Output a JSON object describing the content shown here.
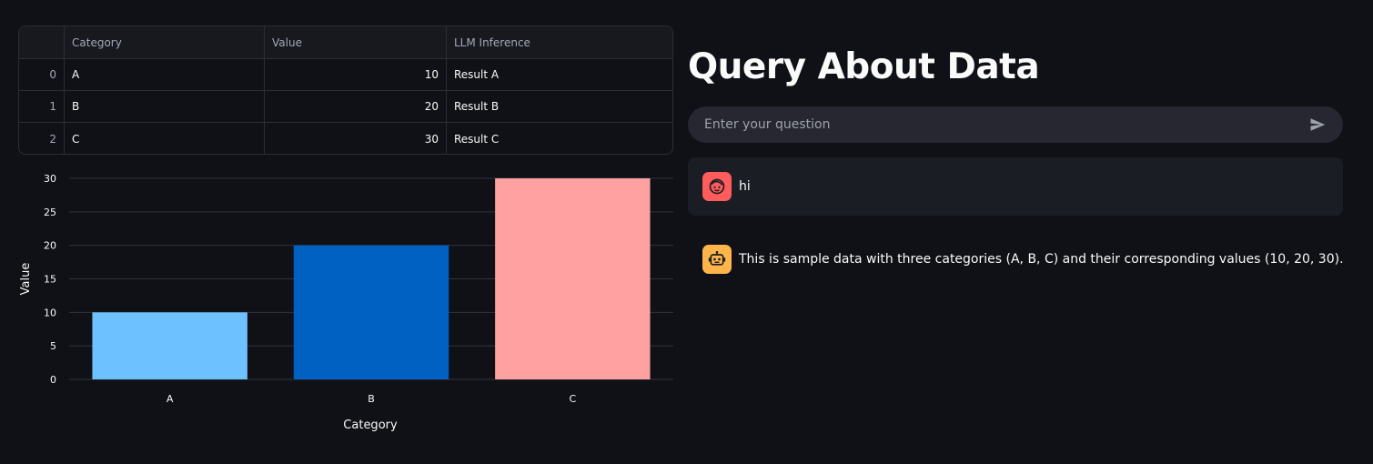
{
  "table": {
    "columns": [
      "",
      "Category",
      "Value",
      "LLM Inference"
    ],
    "rows": [
      {
        "index": "0",
        "category": "A",
        "value": "10",
        "llm": "Result A"
      },
      {
        "index": "1",
        "category": "B",
        "value": "20",
        "llm": "Result B"
      },
      {
        "index": "2",
        "category": "C",
        "value": "30",
        "llm": "Result C"
      }
    ]
  },
  "chart_data": {
    "type": "bar",
    "categories": [
      "A",
      "B",
      "C"
    ],
    "values": [
      10,
      20,
      30
    ],
    "colors": [
      "#6ec1ff",
      "#0061c3",
      "#ffa1a1"
    ],
    "xlabel": "Category",
    "ylabel": "Value",
    "ylim": [
      0,
      30
    ],
    "yticks": [
      0,
      5,
      10,
      15,
      20,
      25,
      30
    ],
    "grid": true,
    "grid_color": "#31333d"
  },
  "query": {
    "title": "Query About Data",
    "input_placeholder": "Enter your question",
    "input_value": "",
    "send_icon": "send-icon"
  },
  "messages": [
    {
      "role": "user",
      "avatar_icon": "user-face-icon",
      "avatar_color": "#ff5c5c",
      "text": "hi"
    },
    {
      "role": "assistant",
      "avatar_icon": "robot-icon",
      "avatar_color": "#ffb54a",
      "text": "This is sample data with three categories (A, B, C) and their corresponding values (10, 20, 30)."
    }
  ]
}
